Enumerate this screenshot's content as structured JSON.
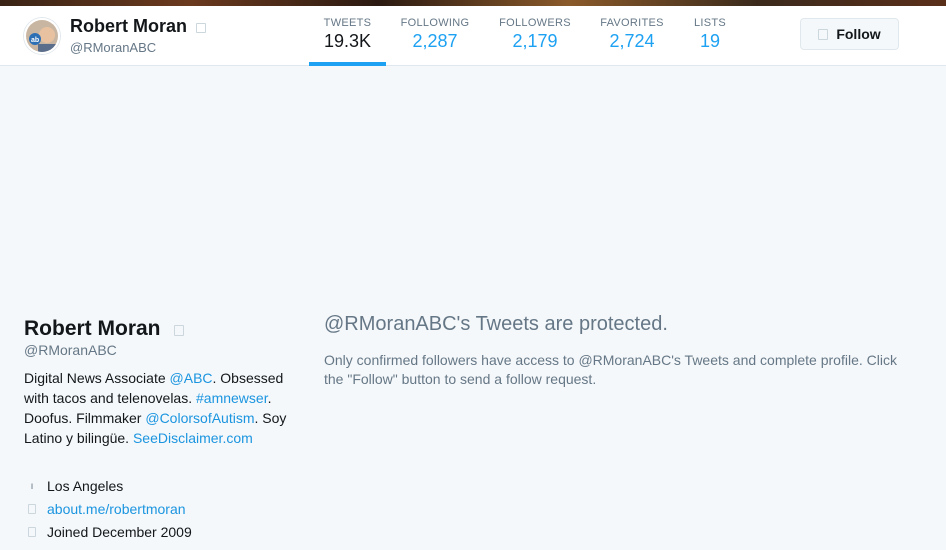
{
  "navbar": {
    "name": "Robert Moran",
    "handle": "@RMoranABC",
    "stats": [
      {
        "label": "TWEETS",
        "value": "19.3K"
      },
      {
        "label": "FOLLOWING",
        "value": "2,287"
      },
      {
        "label": "FOLLOWERS",
        "value": "2,179"
      },
      {
        "label": "FAVORITES",
        "value": "2,724"
      },
      {
        "label": "LISTS",
        "value": "19"
      }
    ],
    "follow_label": "Follow"
  },
  "profile": {
    "name": "Robert Moran",
    "handle": "@RMoranABC",
    "bio": {
      "part1": "Digital News Associate ",
      "mention1": "@ABC",
      "part2": ". Obsessed with tacos and telenovelas. ",
      "hashtag": "#amnewser",
      "part3": ". Doofus. Filmmaker ",
      "mention2": "@ColorsofAutism",
      "part4": ". Soy Latino y bilingüe. ",
      "link": "SeeDisclaimer.com"
    },
    "location": "Los Angeles",
    "website": "about.me/robertmoran",
    "joined": "Joined December 2009"
  },
  "protected": {
    "title": "@RMoranABC's Tweets are protected.",
    "text": "Only confirmed followers have access to @RMoranABC's Tweets and complete profile. Click the \"Follow\" button to send a follow request."
  },
  "colors": {
    "accent": "#1da1f2",
    "link": "#1b95e0",
    "muted": "#657786",
    "background": "#f5f8fa"
  }
}
